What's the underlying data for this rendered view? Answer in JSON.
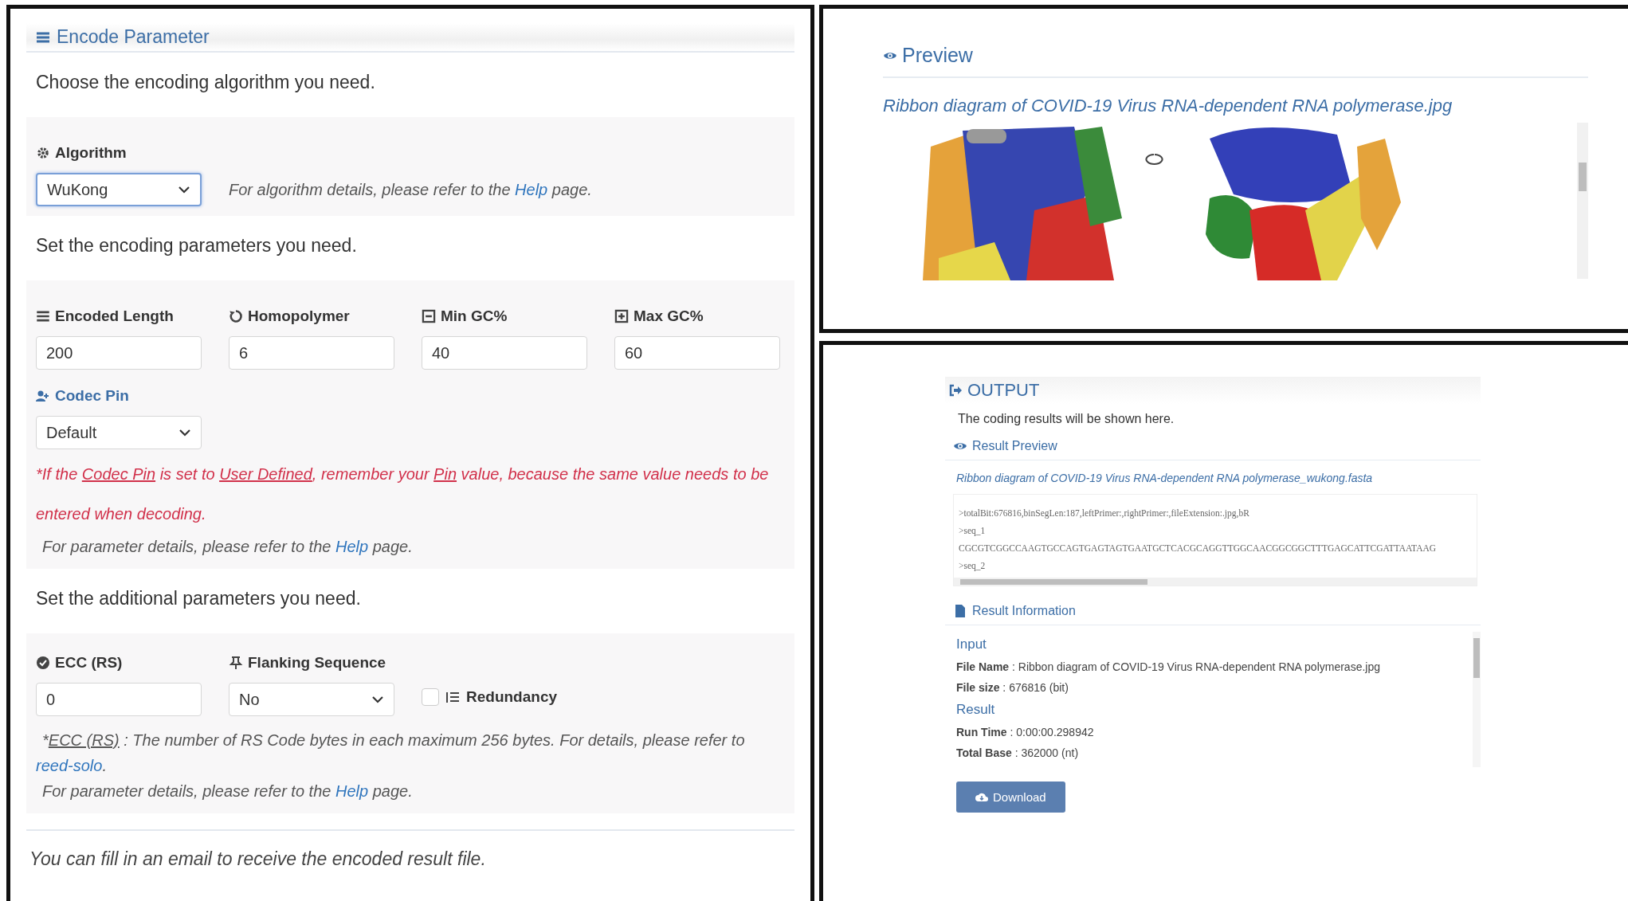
{
  "encode_panel": {
    "title": "Encode Parameter",
    "algorithm_prompt": "Choose the encoding algorithm you need.",
    "algorithm": {
      "label": "Algorithm",
      "value": "WuKong"
    },
    "algorithm_note": [
      {
        "text": "For algorithm details, please refer to the ",
        "kind": "plain"
      },
      {
        "text": "Help",
        "kind": "link"
      },
      {
        "text": " page.",
        "kind": "plain"
      }
    ],
    "encoding_prompt": "Set the encoding parameters you need.",
    "encoding_fields": [
      {
        "label": "Encoded Length",
        "value": "200"
      },
      {
        "label": "Homopolymer",
        "value": "6"
      },
      {
        "label": "Min GC%",
        "value": "40"
      },
      {
        "label": "Max GC%",
        "value": "60"
      }
    ],
    "codec_pin": {
      "label": "Codec Pin",
      "value": "Default"
    },
    "pin_warning": [
      {
        "text": "*If the ",
        "kind": "plain"
      },
      {
        "text": "Codec Pin",
        "kind": "underline"
      },
      {
        "text": " is set to ",
        "kind": "plain"
      },
      {
        "text": "User Defined",
        "kind": "underline"
      },
      {
        "text": ", remember your ",
        "kind": "plain"
      },
      {
        "text": "Pin",
        "kind": "underline"
      },
      {
        "text": " value, because the same value needs to be entered when decoding.",
        "kind": "plain"
      }
    ],
    "encoding_note": [
      {
        "text": "For parameter details, please refer to the ",
        "kind": "plain"
      },
      {
        "text": "Help",
        "kind": "link"
      },
      {
        "text": " page.",
        "kind": "plain"
      }
    ],
    "additional_prompt": "Set the additional parameters you need.",
    "ecc": {
      "label": "ECC (RS)",
      "value": "0"
    },
    "flanking_sequence": {
      "label": "Flanking Sequence",
      "value": "No"
    },
    "redundancy": {
      "label": "Redundancy",
      "checked": false
    },
    "ecc_note": [
      {
        "text": "*",
        "kind": "plain"
      },
      {
        "text": "ECC (RS)",
        "kind": "underline"
      },
      {
        "text": " : The number of RS Code bytes in each maximum 256 bytes. For details, please refer to ",
        "kind": "plain"
      },
      {
        "text": "reed-solo",
        "kind": "link"
      },
      {
        "text": ".",
        "kind": "plain"
      }
    ],
    "additional_note": [
      {
        "text": "For parameter details, please refer to the ",
        "kind": "plain"
      },
      {
        "text": "Help",
        "kind": "link"
      },
      {
        "text": " page.",
        "kind": "plain"
      }
    ],
    "email_prompt": "You can fill in an email to receive the encoded result file."
  },
  "preview_panel": {
    "title": "Preview",
    "file_name": "Ribbon diagram of COVID-19 Virus RNA-dependent RNA polymerase.jpg"
  },
  "output_panel": {
    "title": "OUTPUT",
    "description": "The coding results will be shown here.",
    "result_preview": {
      "title": "Result Preview",
      "file_name": "Ribbon diagram of COVID-19 Virus RNA-dependent RNA polymerase_wukong.fasta",
      "lines": [
        ">totalBit:676816,binSegLen:187,leftPrimer:,rightPrimer:,fileExtension:.jpg,bR",
        ">seq_1",
        "CGCGTCGGCCAAGTGCCAGTGAGTAGTGAATGCTCACGCAGGTTGGCAACGGCGGCTTTGAGCATTCGATTAATAAG",
        ">seq_2"
      ]
    },
    "result_information": {
      "title": "Result Information",
      "groups": [
        {
          "heading": "Input",
          "rows": [
            "**File Name** : Ribbon diagram of COVID-19 Virus RNA-dependent RNA polymerase.jpg",
            "**File size** : 676816 (bit)"
          ]
        },
        {
          "heading": "Result",
          "rows": [
            "**Run Time** : 0:00:00.298942",
            "**Total Base** : 362000 (nt)"
          ]
        }
      ]
    },
    "download_button": "Download"
  }
}
